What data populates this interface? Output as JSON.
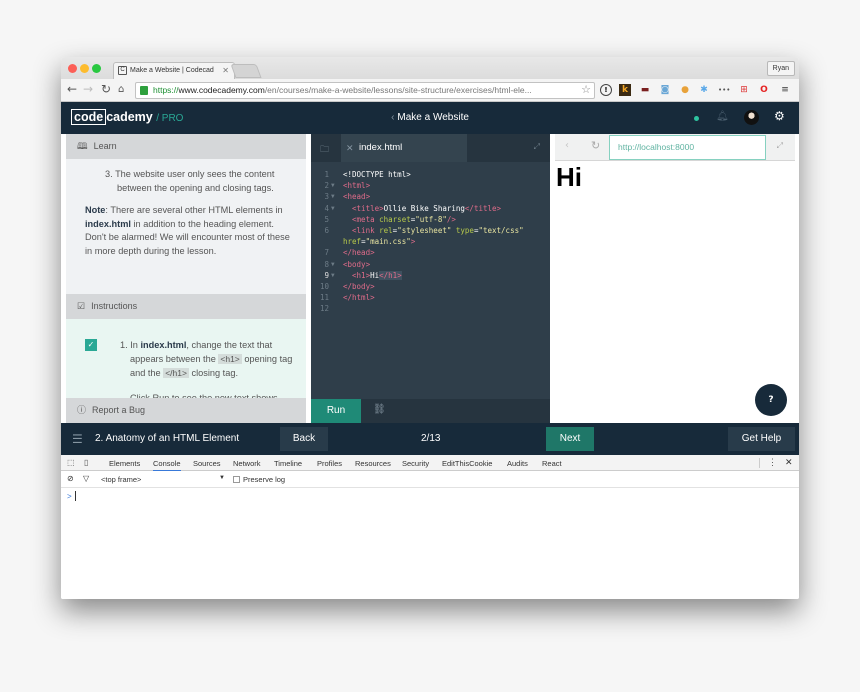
{
  "browser": {
    "tab_title": "Make a Website | Codecademy",
    "tab_title_visible": "Make a Website | Codecad",
    "profile_name": "Ryan",
    "url_scheme": "https://",
    "url_host": "www.codecademy.com",
    "url_path": "/en/courses/make-a-website/lessons/site-structure/exercises/html-ele...",
    "extensions": [
      "info-icon",
      "keeper-icon",
      "incognito-icon",
      "camera-icon",
      "cookie-icon",
      "react-icon",
      "more-icon",
      "adblock-icon",
      "opera-icon",
      "menu-icon"
    ]
  },
  "header": {
    "logo_box": "code",
    "logo_rest": "cademy",
    "logo_pro": "/ PRO",
    "course_title": "Make a Website",
    "status_color": "#2ec4a0"
  },
  "learn": {
    "heading": "Learn",
    "list_item_number": "3.",
    "list_item_text": "The website user only sees the content between the opening and closing tags.",
    "note_label": "Note",
    "note_text_1": ": There are several other HTML elements in ",
    "note_file": "index.html",
    "note_text_2": " in addition to the heading element. Don't be alarmed! We will encounter most of these in more depth during the lesson."
  },
  "instructions": {
    "heading": "Instructions",
    "step_number": "1.",
    "step_text_1": "In ",
    "step_file": "index.html",
    "step_text_2": ", change the text that appears between the ",
    "code_open": "<h1>",
    "step_text_3": " opening tag and the ",
    "code_close": "</h1>",
    "step_text_4": " closing tag.",
    "step_more": "Click Run to see the new text shows",
    "completed": true
  },
  "report_bug": "Report a Bug",
  "editor": {
    "file_name": "index.html",
    "run_label": "Run",
    "lines": [
      {
        "n": "1",
        "fold": false
      },
      {
        "n": "2",
        "fold": true
      },
      {
        "n": "3",
        "fold": true
      },
      {
        "n": "4",
        "fold": true
      },
      {
        "n": "5",
        "fold": false
      },
      {
        "n": "6",
        "fold": false
      },
      {
        "n": "",
        "fold": false
      },
      {
        "n": "7",
        "fold": false
      },
      {
        "n": "8",
        "fold": true
      },
      {
        "n": "9",
        "fold": true
      },
      {
        "n": "10",
        "fold": false
      },
      {
        "n": "11",
        "fold": false
      },
      {
        "n": "12",
        "fold": false
      }
    ],
    "code": {
      "doctype": "<!DOCTYPE html>",
      "html_open": "<html>",
      "head_open": "<head>",
      "title_open": "<title>",
      "title_text": "Ollie Bike Sharing",
      "title_close": "</title>",
      "meta_open": "<meta ",
      "meta_attr": "charset",
      "meta_val": "\"utf-8\"",
      "meta_close": "/>",
      "link_open": "<link ",
      "rel_attr": "rel",
      "rel_val": "\"stylesheet\"",
      "type_attr": "type",
      "type_val": "\"text/css\"",
      "href_attr": "href",
      "href_val": "\"main.css\"",
      "link_close": ">",
      "eq": "=",
      "head_close": "</head>",
      "body_open": "<body>",
      "h1_open": "<h1>",
      "h1_text": "Hi",
      "h1_close": "</h1>",
      "body_close": "</body>",
      "html_close": "</html>"
    }
  },
  "preview": {
    "url": "http://localhost:8000",
    "rendered_h1": "Hi",
    "help_icon": "?"
  },
  "bottom_nav": {
    "lesson": "2. Anatomy of an HTML Element",
    "back_label": "Back",
    "progress": "2/13",
    "next_label": "Next",
    "help_label": "Get Help"
  },
  "devtools": {
    "tabs": [
      "Elements",
      "Console",
      "Sources",
      "Network",
      "Timeline",
      "Profiles",
      "Resources",
      "Security",
      "EditThisCookie",
      "Audits",
      "React"
    ],
    "active_tab": "Console",
    "context": "<top frame>",
    "preserve_log_label": "Preserve log",
    "preserve_log": false,
    "prompt": ">"
  }
}
